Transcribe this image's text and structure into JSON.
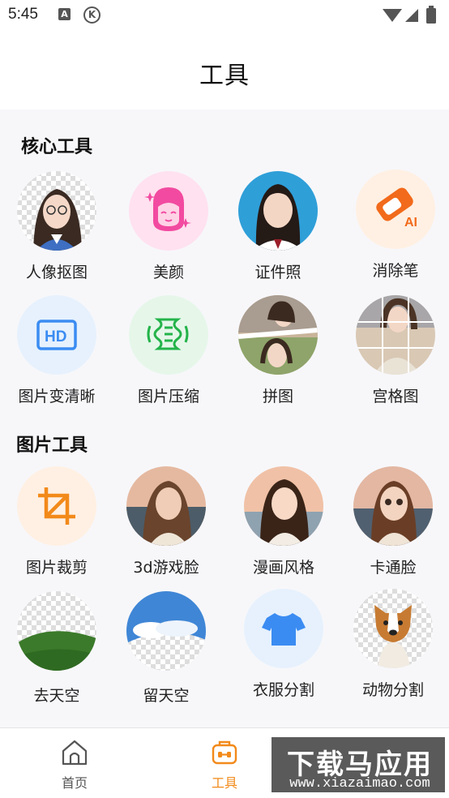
{
  "status_bar": {
    "time": "5:45",
    "notification_a": "A",
    "notification_k": "K"
  },
  "header": {
    "title": "工具"
  },
  "sections": {
    "core": {
      "title": "核心工具",
      "items": [
        {
          "label": "人像抠图",
          "icon": "portrait-cutout-icon"
        },
        {
          "label": "美颜",
          "icon": "beauty-face-icon"
        },
        {
          "label": "证件照",
          "icon": "id-photo-icon"
        },
        {
          "label": "消除笔",
          "icon": "ai-eraser-icon"
        },
        {
          "label": "图片变清晰",
          "icon": "hd-icon"
        },
        {
          "label": "图片压缩",
          "icon": "compress-icon"
        },
        {
          "label": "拼图",
          "icon": "collage-icon"
        },
        {
          "label": "宫格图",
          "icon": "grid-image-icon"
        }
      ]
    },
    "image": {
      "title": "图片工具",
      "items": [
        {
          "label": "图片裁剪",
          "icon": "crop-icon"
        },
        {
          "label": "3d游戏脸",
          "icon": "game-face-icon"
        },
        {
          "label": "漫画风格",
          "icon": "comic-style-icon"
        },
        {
          "label": "卡通脸",
          "icon": "cartoon-face-icon"
        },
        {
          "label": "去天空",
          "icon": "remove-sky-icon"
        },
        {
          "label": "留天空",
          "icon": "keep-sky-icon"
        },
        {
          "label": "衣服分割",
          "icon": "clothing-segment-icon"
        },
        {
          "label": "动物分割",
          "icon": "animal-segment-icon"
        }
      ]
    }
  },
  "bottom_nav": {
    "home": "首页",
    "tools": "工具"
  },
  "watermark": {
    "title": "下载马应用",
    "url": "www.xiazaimao.com"
  },
  "colors": {
    "accent": "#f28a1a",
    "nav_inactive": "#555555",
    "blue": "#3b8cf2",
    "green": "#24b34a",
    "pink": "#f24aa0"
  }
}
